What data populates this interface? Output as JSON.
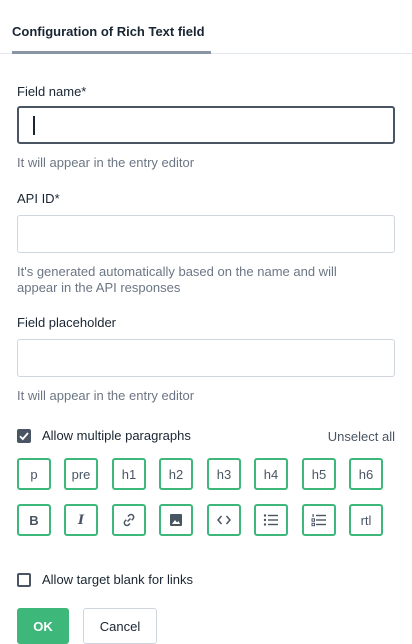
{
  "header": {
    "tab_label": "Configuration of Rich Text field"
  },
  "form": {
    "field_name": {
      "label": "Field name*",
      "value": "",
      "hint": "It will appear in the entry editor"
    },
    "api_id": {
      "label": "API ID*",
      "value": "",
      "hint_line1": "It's generated automatically based on the name and will",
      "hint_line2": "appear in the API responses"
    },
    "placeholder": {
      "label": "Field placeholder",
      "value": "",
      "hint": "It will appear in the entry editor"
    },
    "allow_paragraphs": {
      "label": "Allow multiple paragraphs",
      "checked": true
    },
    "unselect_all": "Unselect all",
    "toolbar_row1": [
      "p",
      "pre",
      "h1",
      "h2",
      "h3",
      "h4",
      "h5",
      "h6"
    ],
    "toolbar_row2": [
      {
        "name": "bold-icon",
        "text": "B"
      },
      {
        "name": "italic-icon",
        "text": "I"
      },
      {
        "name": "link-icon"
      },
      {
        "name": "image-icon"
      },
      {
        "name": "code-icon"
      },
      {
        "name": "bulleted-list-icon"
      },
      {
        "name": "numbered-list-icon"
      },
      {
        "name": "rtl",
        "text": "rtl"
      }
    ],
    "allow_target_blank": {
      "label": "Allow target blank for links",
      "checked": false
    }
  },
  "actions": {
    "ok": "OK",
    "cancel": "Cancel"
  },
  "colors": {
    "accent": "#3eb77b",
    "text": "#192532",
    "muted": "#6b7684",
    "border": "#d0d6de"
  }
}
